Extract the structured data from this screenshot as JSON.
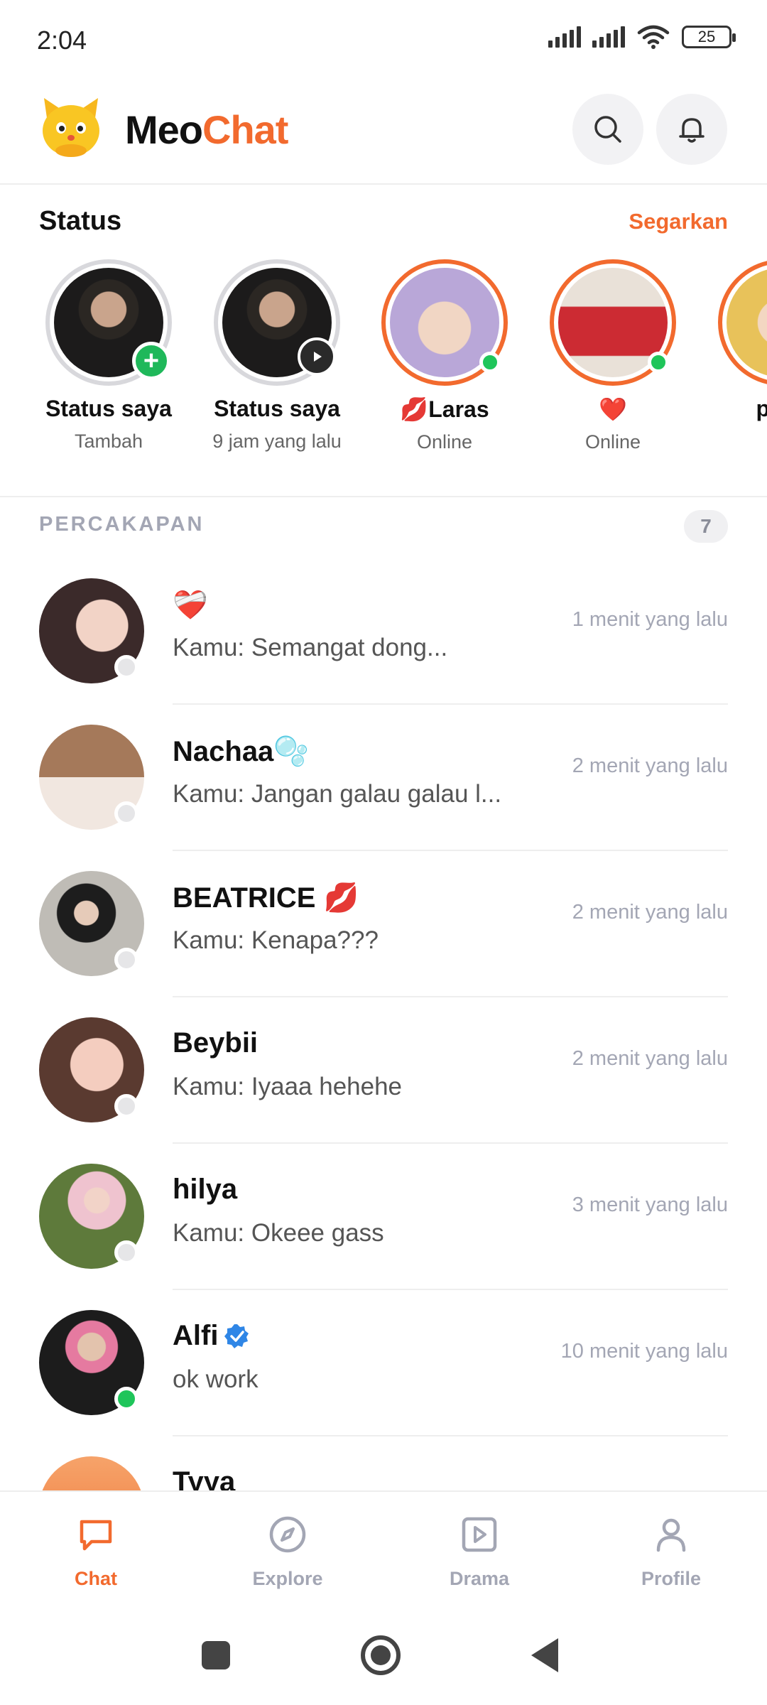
{
  "statusbar": {
    "time": "2:04",
    "battery": "25"
  },
  "header": {
    "brand_part1": "Meo",
    "brand_part2": "Chat",
    "brand_accent": "#f26a2e"
  },
  "status_section": {
    "title": "Status",
    "refresh_label": "Segarkan",
    "stories": [
      {
        "name": "Status saya",
        "sub": "Tambah",
        "badge": "add"
      },
      {
        "name": "Status saya",
        "sub": "9 jam yang lalu",
        "badge": "play"
      },
      {
        "name": "💋Laras",
        "sub": "Online",
        "badge": "online"
      },
      {
        "name": "❤️",
        "sub": "Online",
        "badge": "online"
      },
      {
        "name": "putri",
        "sub": "O",
        "badge": "none"
      }
    ]
  },
  "conversations": {
    "title": "PERCAKAPAN",
    "count": "7",
    "items": [
      {
        "name": "❤️‍🩹",
        "message": "Kamu: Semangat dong...",
        "time": "1 menit yang lalu",
        "online": false
      },
      {
        "name": "Nachaa🫧",
        "message": "Kamu: Jangan galau galau l...",
        "time": "2 menit yang lalu",
        "online": false
      },
      {
        "name": "BEATRICE 💋",
        "message": "Kamu: Kenapa???",
        "time": "2 menit yang lalu",
        "online": false
      },
      {
        "name": "Beybii",
        "message": "Kamu: Iyaaa hehehe",
        "time": "2 menit yang lalu",
        "online": false
      },
      {
        "name": "hilya",
        "message": "Kamu: Okeee gass",
        "time": "3 menit yang lalu",
        "online": false
      },
      {
        "name": "Alfi",
        "message": "ok work",
        "time": "10 menit yang lalu",
        "online": true,
        "verified": true
      },
      {
        "name": "Tyya",
        "message": "",
        "time": "",
        "online": false
      }
    ]
  },
  "bottom_nav": [
    {
      "label": "Chat",
      "icon": "chat-icon",
      "active": true
    },
    {
      "label": "Explore",
      "icon": "compass-icon",
      "active": false
    },
    {
      "label": "Drama",
      "icon": "play-square-icon",
      "active": false
    },
    {
      "label": "Profile",
      "icon": "person-icon",
      "active": false
    }
  ]
}
